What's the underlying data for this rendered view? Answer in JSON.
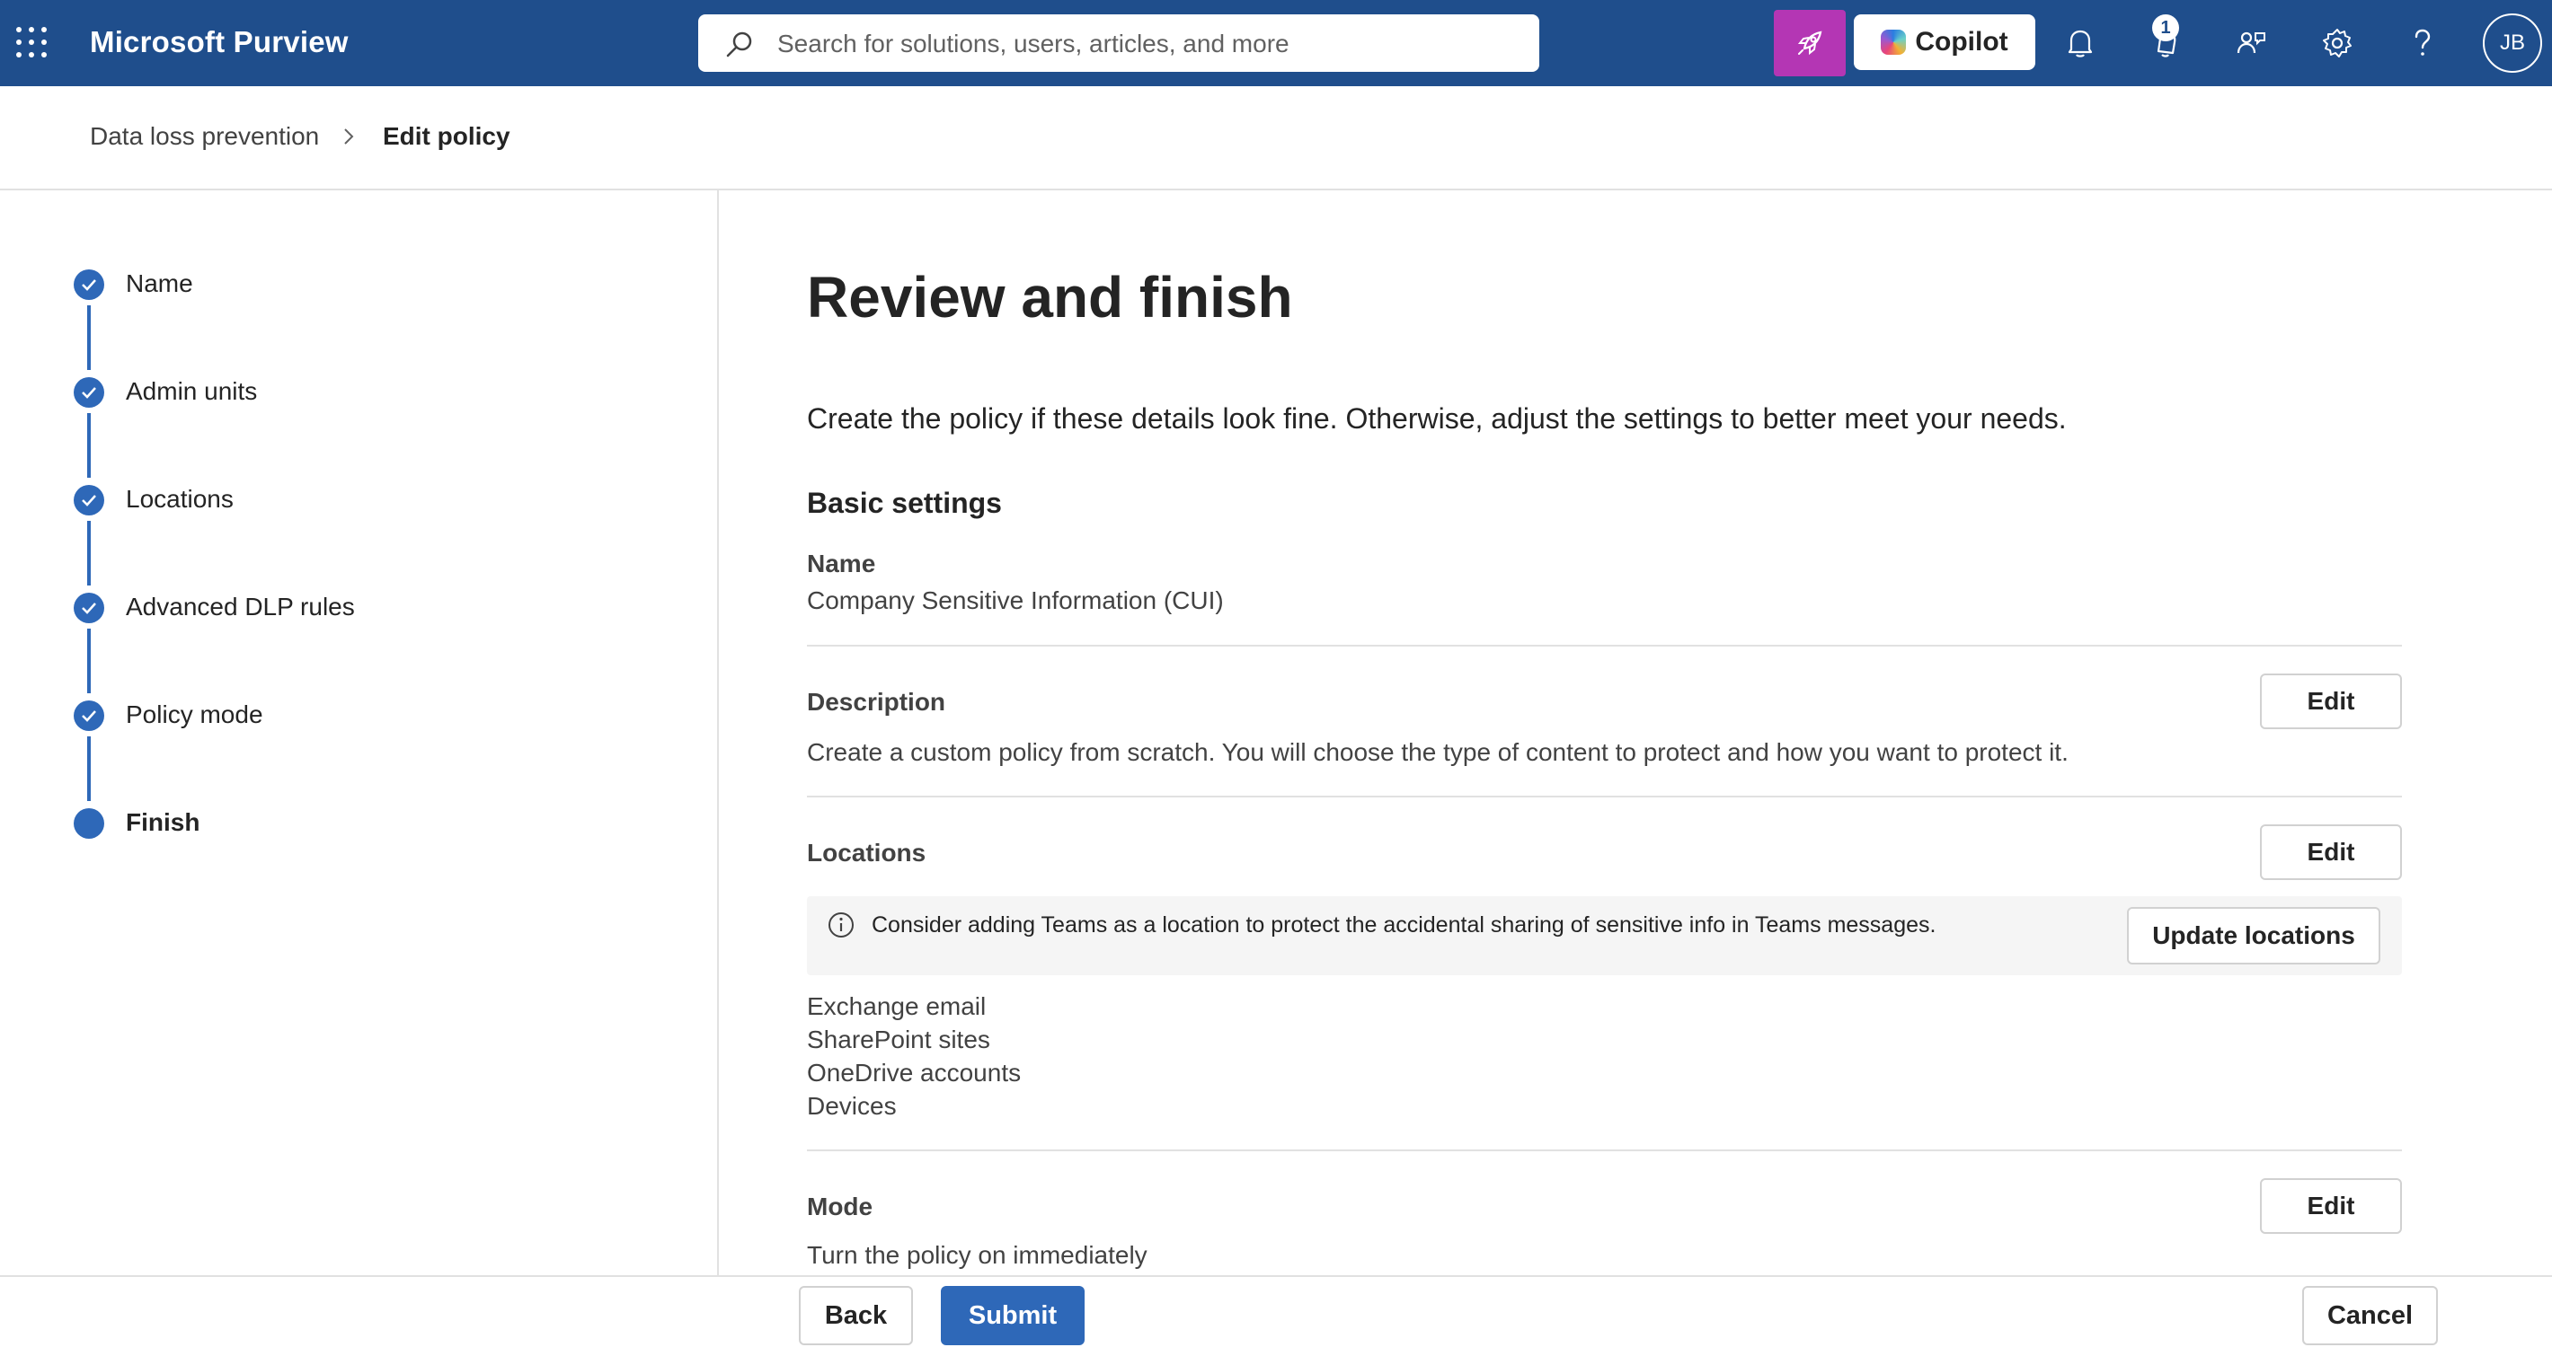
{
  "topbar": {
    "app_title": "Microsoft Purview",
    "search_placeholder": "Search for solutions, users, articles, and more",
    "copilot_label": "Copilot",
    "notification_badge": "1",
    "avatar_initials": "JB",
    "brand_color": "#1f4e8c",
    "rocket_color": "#b436b4",
    "icons": [
      "app-launcher-icon",
      "search-icon",
      "rocket-icon",
      "bell-icon",
      "whats-new-icon",
      "people-icon",
      "gear-icon",
      "help-icon"
    ]
  },
  "breadcrumb": {
    "items": [
      "Data loss prevention",
      "Edit policy"
    ]
  },
  "steps": [
    {
      "label": "Name",
      "status": "complete"
    },
    {
      "label": "Admin units",
      "status": "complete"
    },
    {
      "label": "Locations",
      "status": "complete"
    },
    {
      "label": "Advanced DLP rules",
      "status": "complete"
    },
    {
      "label": "Policy mode",
      "status": "complete"
    },
    {
      "label": "Finish",
      "status": "current"
    }
  ],
  "main": {
    "title": "Review and finish",
    "intro": "Create the policy if these details look fine. Otherwise, adjust the settings to better meet your needs.",
    "section_heading": "Basic settings",
    "name": {
      "label": "Name",
      "value": "Company Sensitive Information (CUI)"
    },
    "description": {
      "label": "Description",
      "value": "Create a custom policy from scratch. You will choose the type of content to protect and how you want to protect it.",
      "edit_label": "Edit"
    },
    "locations": {
      "label": "Locations",
      "edit_label": "Edit",
      "info_text": "Consider adding Teams as a location to protect the accidental sharing of sensitive info in Teams messages.",
      "update_label": "Update locations",
      "items": [
        "Exchange email",
        "SharePoint sites",
        "OneDrive accounts",
        "Devices"
      ]
    },
    "mode": {
      "label": "Mode",
      "value": "Turn the policy on immediately",
      "edit_label": "Edit"
    }
  },
  "footer": {
    "back_label": "Back",
    "submit_label": "Submit",
    "cancel_label": "Cancel"
  }
}
